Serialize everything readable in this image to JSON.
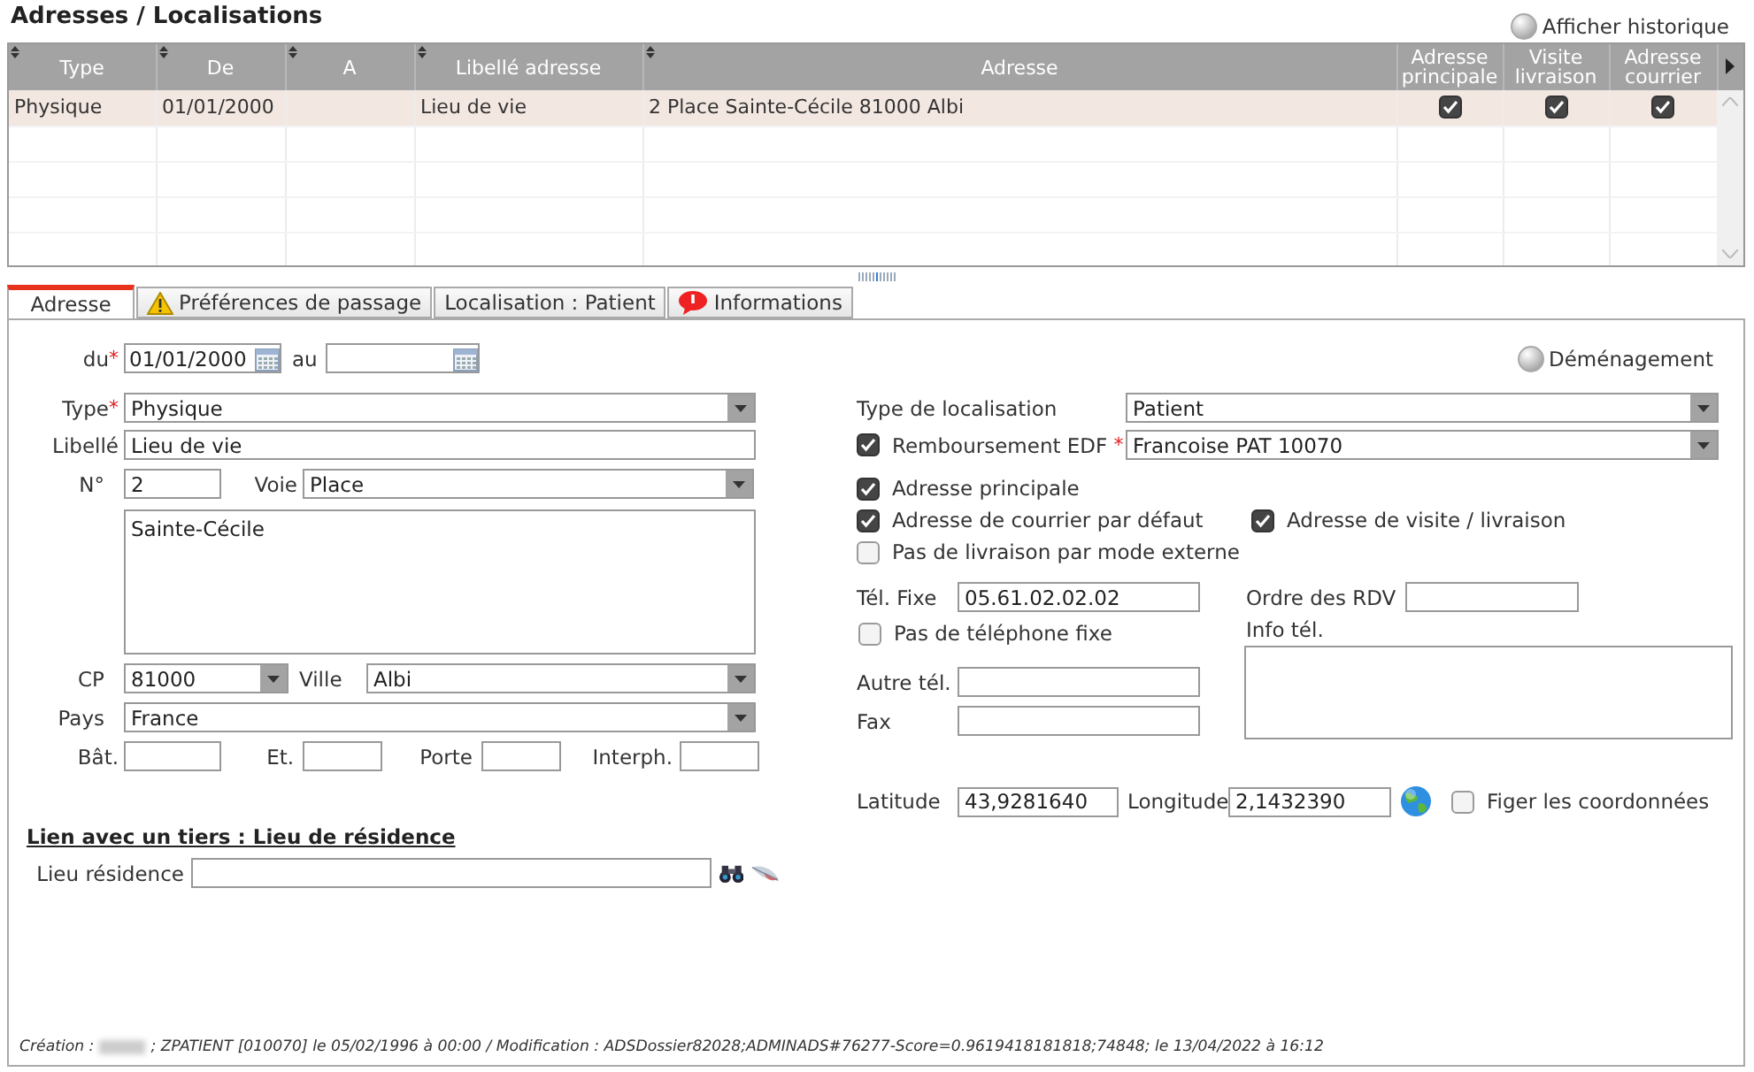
{
  "title": "Adresses / Localisations",
  "history_button": {
    "label": "Afficher historique"
  },
  "table": {
    "columns": [
      {
        "label": "Type",
        "sortable": true
      },
      {
        "label": "De",
        "sortable": true
      },
      {
        "label": "A",
        "sortable": true
      },
      {
        "label": "Libellé adresse",
        "sortable": true
      },
      {
        "label": "Adresse",
        "sortable": true
      },
      {
        "label": "Adresse principale",
        "sortable": false
      },
      {
        "label": "Visite livraison",
        "sortable": false
      },
      {
        "label": "Adresse courrier",
        "sortable": false
      }
    ],
    "rows": [
      {
        "selected": true,
        "type": "Physique",
        "from": "01/01/2000",
        "label": "Lieu de vie",
        "address": "2 Place Sainte-Cécile 81000 Albi",
        "checks": [
          true,
          true,
          true
        ]
      }
    ]
  },
  "tabs": [
    {
      "label": "Adresse",
      "selected": true
    },
    {
      "label": "Préférences de passage",
      "kind": "warning",
      "selected": false
    },
    {
      "label": "Localisation : Patient",
      "selected": false
    },
    {
      "label": "Informations",
      "kind": "info",
      "selected": false
    }
  ],
  "address_form": {
    "from": {
      "label": "du",
      "required_mark": "*",
      "value": "01/01/2000"
    },
    "to": {
      "label": "au"
    },
    "type": {
      "label": "Type",
      "required_mark": "*",
      "value": "Physique"
    },
    "label_field": {
      "label": "Libellé",
      "value": "Lieu de vie"
    },
    "number": {
      "label": "N°",
      "value": "2"
    },
    "street_type": {
      "label": "Voie",
      "value": "Place"
    },
    "street": {
      "value": "Sainte-Cécile"
    },
    "postcode": {
      "label": "CP",
      "value": "81000"
    },
    "city": {
      "label": "Ville",
      "value": "Albi"
    },
    "country": {
      "label": "Pays",
      "value": "France"
    },
    "building": {
      "label": "Bât."
    },
    "stairs": {
      "label": "Et."
    },
    "door": {
      "label": "Porte"
    },
    "intercom": {
      "label": "Interph."
    }
  },
  "localisation": {
    "move_button": {
      "label": "Déménagement"
    },
    "type": {
      "label": "Type de localisation",
      "value": "Patient"
    },
    "reimbursement": {
      "label": "Remboursement EDF",
      "checked": true,
      "required_mark": "*",
      "value": "Francoise PAT 10070"
    },
    "main_address": {
      "label": "Adresse principale",
      "checked": true
    },
    "mail_address": {
      "label": "Adresse de courrier par défaut",
      "checked": true
    },
    "visit_address": {
      "label": "Adresse de visite / livraison",
      "checked": true
    },
    "no_external_delivery": {
      "label": "Pas de livraison par mode externe",
      "checked": false
    },
    "phone": {
      "label": "Tél. Fixe",
      "value": "05.61.02.02.02"
    },
    "appointment_order": {
      "label": "Ordre des RDV"
    },
    "no_phone": {
      "label": "Pas de téléphone fixe",
      "checked": false
    },
    "phone_info": {
      "label": "Info tél."
    },
    "other_phone": {
      "label": "Autre tél."
    },
    "fax": {
      "label": "Fax"
    },
    "latitude": {
      "label": "Latitude",
      "value": "43,9281640"
    },
    "longitude": {
      "label": "Longitude",
      "value": "2,1432390"
    },
    "freeze": {
      "label": "Figer les coordonnées",
      "checked": false
    }
  },
  "third_party": {
    "title": "Lien avec un tiers : Lieu de résidence",
    "residence": {
      "label": "Lieu résidence"
    }
  },
  "footer": {
    "prefix": "Création :",
    "text": "; ZPATIENT [010070] le 05/02/1996 à 00:00 / Modification : ADSDossier82028;ADMINADS#76277-Score=0.9619418181818;74848; le 13/04/2022 à 16:12"
  }
}
